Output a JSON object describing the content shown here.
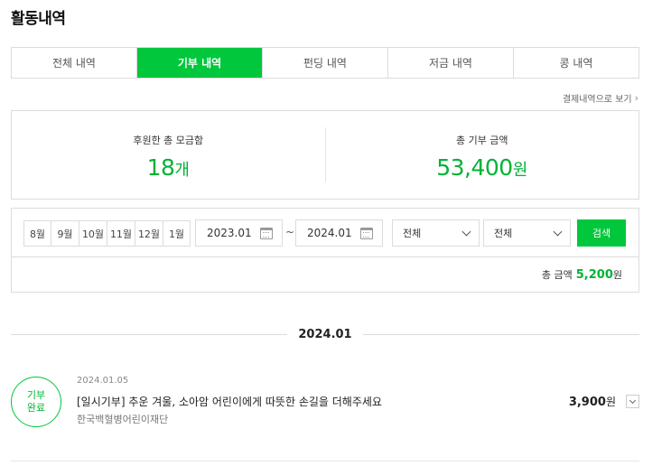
{
  "page": {
    "title": "활동내역"
  },
  "tabs": [
    {
      "label": "전체 내역",
      "active": false
    },
    {
      "label": "기부 내역",
      "active": true
    },
    {
      "label": "펀딩 내역",
      "active": false
    },
    {
      "label": "저금 내역",
      "active": false
    },
    {
      "label": "콩 내역",
      "active": false
    }
  ],
  "payment_link": {
    "label": "결제내역으로 보기"
  },
  "summary": {
    "count_label": "후원한 총 모금함",
    "count_value": "18",
    "count_unit": "개",
    "amount_label": "총 기부 금액",
    "amount_value": "53,400",
    "amount_unit": "원"
  },
  "filter": {
    "months": [
      "8월",
      "9월",
      "10월",
      "11월",
      "12월",
      "1월"
    ],
    "start_date": "2023.01",
    "end_date": "2024.01",
    "range_separator": "~",
    "select1_value": "전체",
    "select2_value": "전체",
    "search_label": "검색",
    "total_label": "총 금액",
    "total_amount": "5,200",
    "total_unit": "원"
  },
  "groups": [
    {
      "date_label": "2024.01",
      "items": [
        {
          "status_line1": "기부",
          "status_line2": "완료",
          "date": "2024.01.05",
          "title": "[일시기부] 추운 겨울, 소아암 어린이에게 따뜻한 손길을 더해주세요",
          "org": "한국백혈병어린이재단",
          "amount": "3,900",
          "amount_unit": "원"
        }
      ]
    }
  ],
  "colors": {
    "accent": "#00c73c",
    "accent_text": "#00b336",
    "border": "#dcdcdc"
  }
}
